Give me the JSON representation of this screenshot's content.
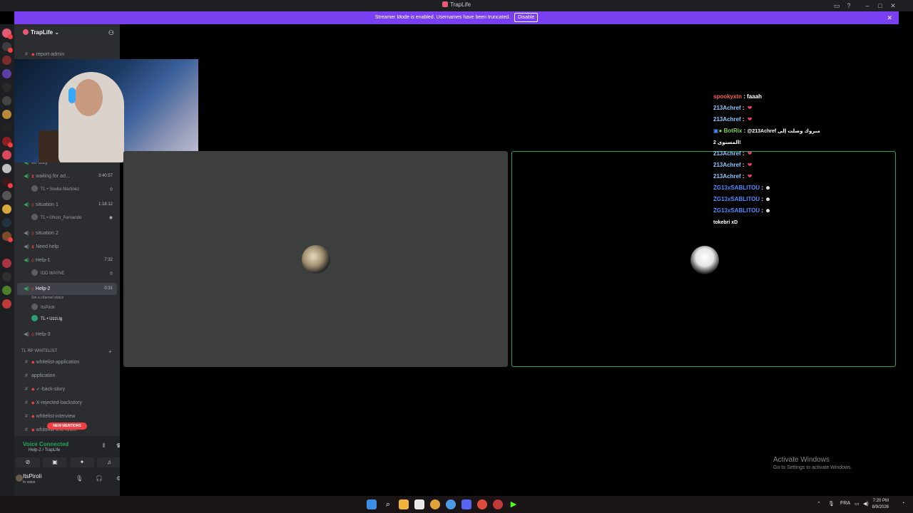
{
  "window": {
    "title": "TrapLife"
  },
  "banner": {
    "text": "Streamer Mode is enabled. Usernames have been truncated.",
    "button": "Disable"
  },
  "server": {
    "name": "TrapLife"
  },
  "channels": {
    "report_admin": "report-admin",
    "off_duty": "off duty",
    "waiting": {
      "label": "waiting for ad...",
      "timer": "3:40:57"
    },
    "waiting_member": "Souba Martinez",
    "situation1": {
      "label": "situation 1",
      "timer": "1:18:12"
    },
    "situation1_member": "Ghost_Fernando",
    "situation2": "situation 2",
    "need_help": "Need help",
    "help1": {
      "label": "Help-1",
      "timer": "7:32"
    },
    "help1_member": "IDD WAYNE",
    "help2": {
      "label": "Help-2",
      "timer": "0:31",
      "status": "Set a channel status"
    },
    "help2_members": [
      "ItsPiroli",
      "Uzzi.lg"
    ],
    "help3": "Help-3",
    "category": "TL RP WHITELIST",
    "whitelist_application": "whitelist-application",
    "application": "application",
    "back_story": "✓-back-story",
    "rejected_backstory": "X-rejected-backstory",
    "whitelist_interview": "whitelist-interview",
    "whitelist_text_room": "whitelist-text-room"
  },
  "new_mentions": "NEW MENTIONS",
  "voice": {
    "status": "Voice Connected",
    "channel": "Help-2 / TrapLife"
  },
  "user": {
    "name": "ItsPiroli",
    "status": "In voice"
  },
  "chat": [
    {
      "user": "spookyxtn",
      "text": "faaah",
      "color": "#ff5d5d"
    },
    {
      "user": "213Achref",
      "text": "",
      "color": "#8ec5ff"
    },
    {
      "user": "213Achref",
      "text": "",
      "color": "#8ec5ff"
    },
    {
      "user": "BotRix",
      "text": "@213Achref مبروك وصلت إلى",
      "color": "#7dd35a"
    },
    {
      "user": "",
      "text": "المستوى 2!",
      "color": "#ffffff"
    },
    {
      "user": "213Achref",
      "text": "",
      "color": "#8ec5ff"
    },
    {
      "user": "213Achref",
      "text": "",
      "color": "#8ec5ff"
    },
    {
      "user": "213Achref",
      "text": "",
      "color": "#8ec5ff"
    },
    {
      "user": "ZG13xSABLITOU",
      "text": "",
      "color": "#4d8cff"
    },
    {
      "user": "ZG13xSABLITOU",
      "text": "",
      "color": "#4d8cff"
    },
    {
      "user": "ZG13xSABLITOU",
      "text": "",
      "color": "#4d8cff"
    },
    {
      "user": "",
      "text": "tokebri xD",
      "color": "#ffffff"
    }
  ],
  "activate": {
    "title": "Activate Windows",
    "sub": "Go to Settings to activate Windows."
  },
  "taskbar": {
    "lang": "FRA",
    "time": "7:20 PM",
    "date": "8/9/2026"
  }
}
